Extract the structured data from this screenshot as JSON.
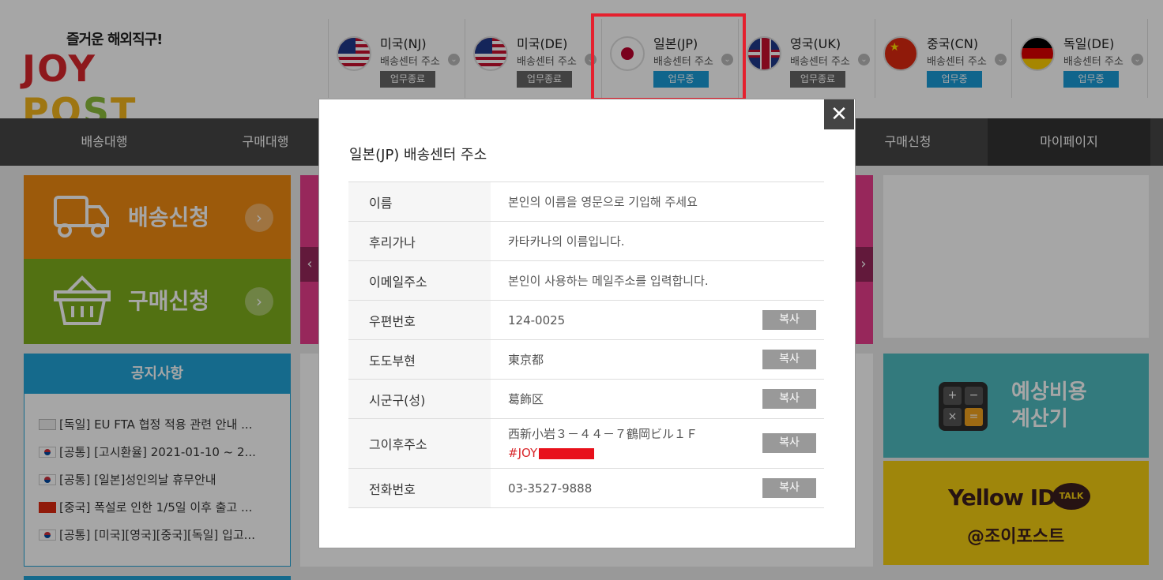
{
  "logo": {
    "tagline": "즐거운 해외직구!",
    "word_joy": "JOY",
    "word_post_pre": "PO",
    "word_post_mid": "S",
    "word_post_end": "T"
  },
  "centers": [
    {
      "name": "미국(NJ)",
      "address_label": "배송센터 주소",
      "status": "업무종료",
      "flag": "us"
    },
    {
      "name": "미국(DE)",
      "address_label": "배송센터 주소",
      "status": "업무종료",
      "flag": "us"
    },
    {
      "name": "일본(JP)",
      "address_label": "배송센터 주소",
      "status": "업무중",
      "flag": "jp"
    },
    {
      "name": "영국(UK)",
      "address_label": "배송센터 주소",
      "status": "업무종료",
      "flag": "uk"
    },
    {
      "name": "중국(CN)",
      "address_label": "배송센터 주소",
      "status": "업무중",
      "flag": "cn"
    },
    {
      "name": "독일(DE)",
      "address_label": "배송센터 주소",
      "status": "업무중",
      "flag": "de"
    }
  ],
  "nav": {
    "shipping_agent": "배송대행",
    "purchase_agent": "구매대행",
    "purchase_request": "구매신청",
    "mypage": "마이페이지"
  },
  "tiles": {
    "shipping_request": "배송신청",
    "purchase_request": "구매신청"
  },
  "notice": {
    "title": "공지사항",
    "items": [
      {
        "flag": "img",
        "text": "[독일] EU FTA 협정 적용 관련 안내 ..."
      },
      {
        "flag": "kr",
        "text": "[공통] [고시환율] 2021-01-10 ~ 2..."
      },
      {
        "flag": "kr",
        "text": "[공통] [일본]성인의날 휴무안내"
      },
      {
        "flag": "cn",
        "text": "[중국] 폭설로 인한 1/5일 이후 출고 ..."
      },
      {
        "flag": "kr",
        "text": "[공통] [미국][영국][중국][독일] 입고..."
      }
    ]
  },
  "calculator": {
    "line1": "예상비용",
    "line2": "계산기"
  },
  "yellowid": {
    "title": "Yellow ID",
    "talk": "TALK",
    "handle": "@조이포스트"
  },
  "modal": {
    "title": "일본(JP) 배송센터 주소",
    "close": "✕",
    "copy_label": "복사",
    "rows": [
      {
        "label": "이름",
        "value": "본인의 이름을 영문으로 기입해 주세요"
      },
      {
        "label": "후리가나",
        "value": "카타카나의 이름입니다."
      },
      {
        "label": "이메일주소",
        "value": "본인이 사용하는 메일주소를 입력합니다."
      },
      {
        "label": "우편번호",
        "value": "124-0025"
      },
      {
        "label": "도도부현",
        "value": "東京都"
      },
      {
        "label": "시군구(성)",
        "value": "葛飾区"
      },
      {
        "label": "그이후주소",
        "value": "西新小岩３－４４－７鶴岡ビル１Ｆ",
        "value2": "#JOY"
      },
      {
        "label": "전화번호",
        "value": "03-3527-9888"
      }
    ]
  },
  "colors": {
    "accent_blue": "#1a9bd7",
    "highlight_red": "#e5202e",
    "orange": "#f08a12",
    "green": "#7fae1d"
  }
}
